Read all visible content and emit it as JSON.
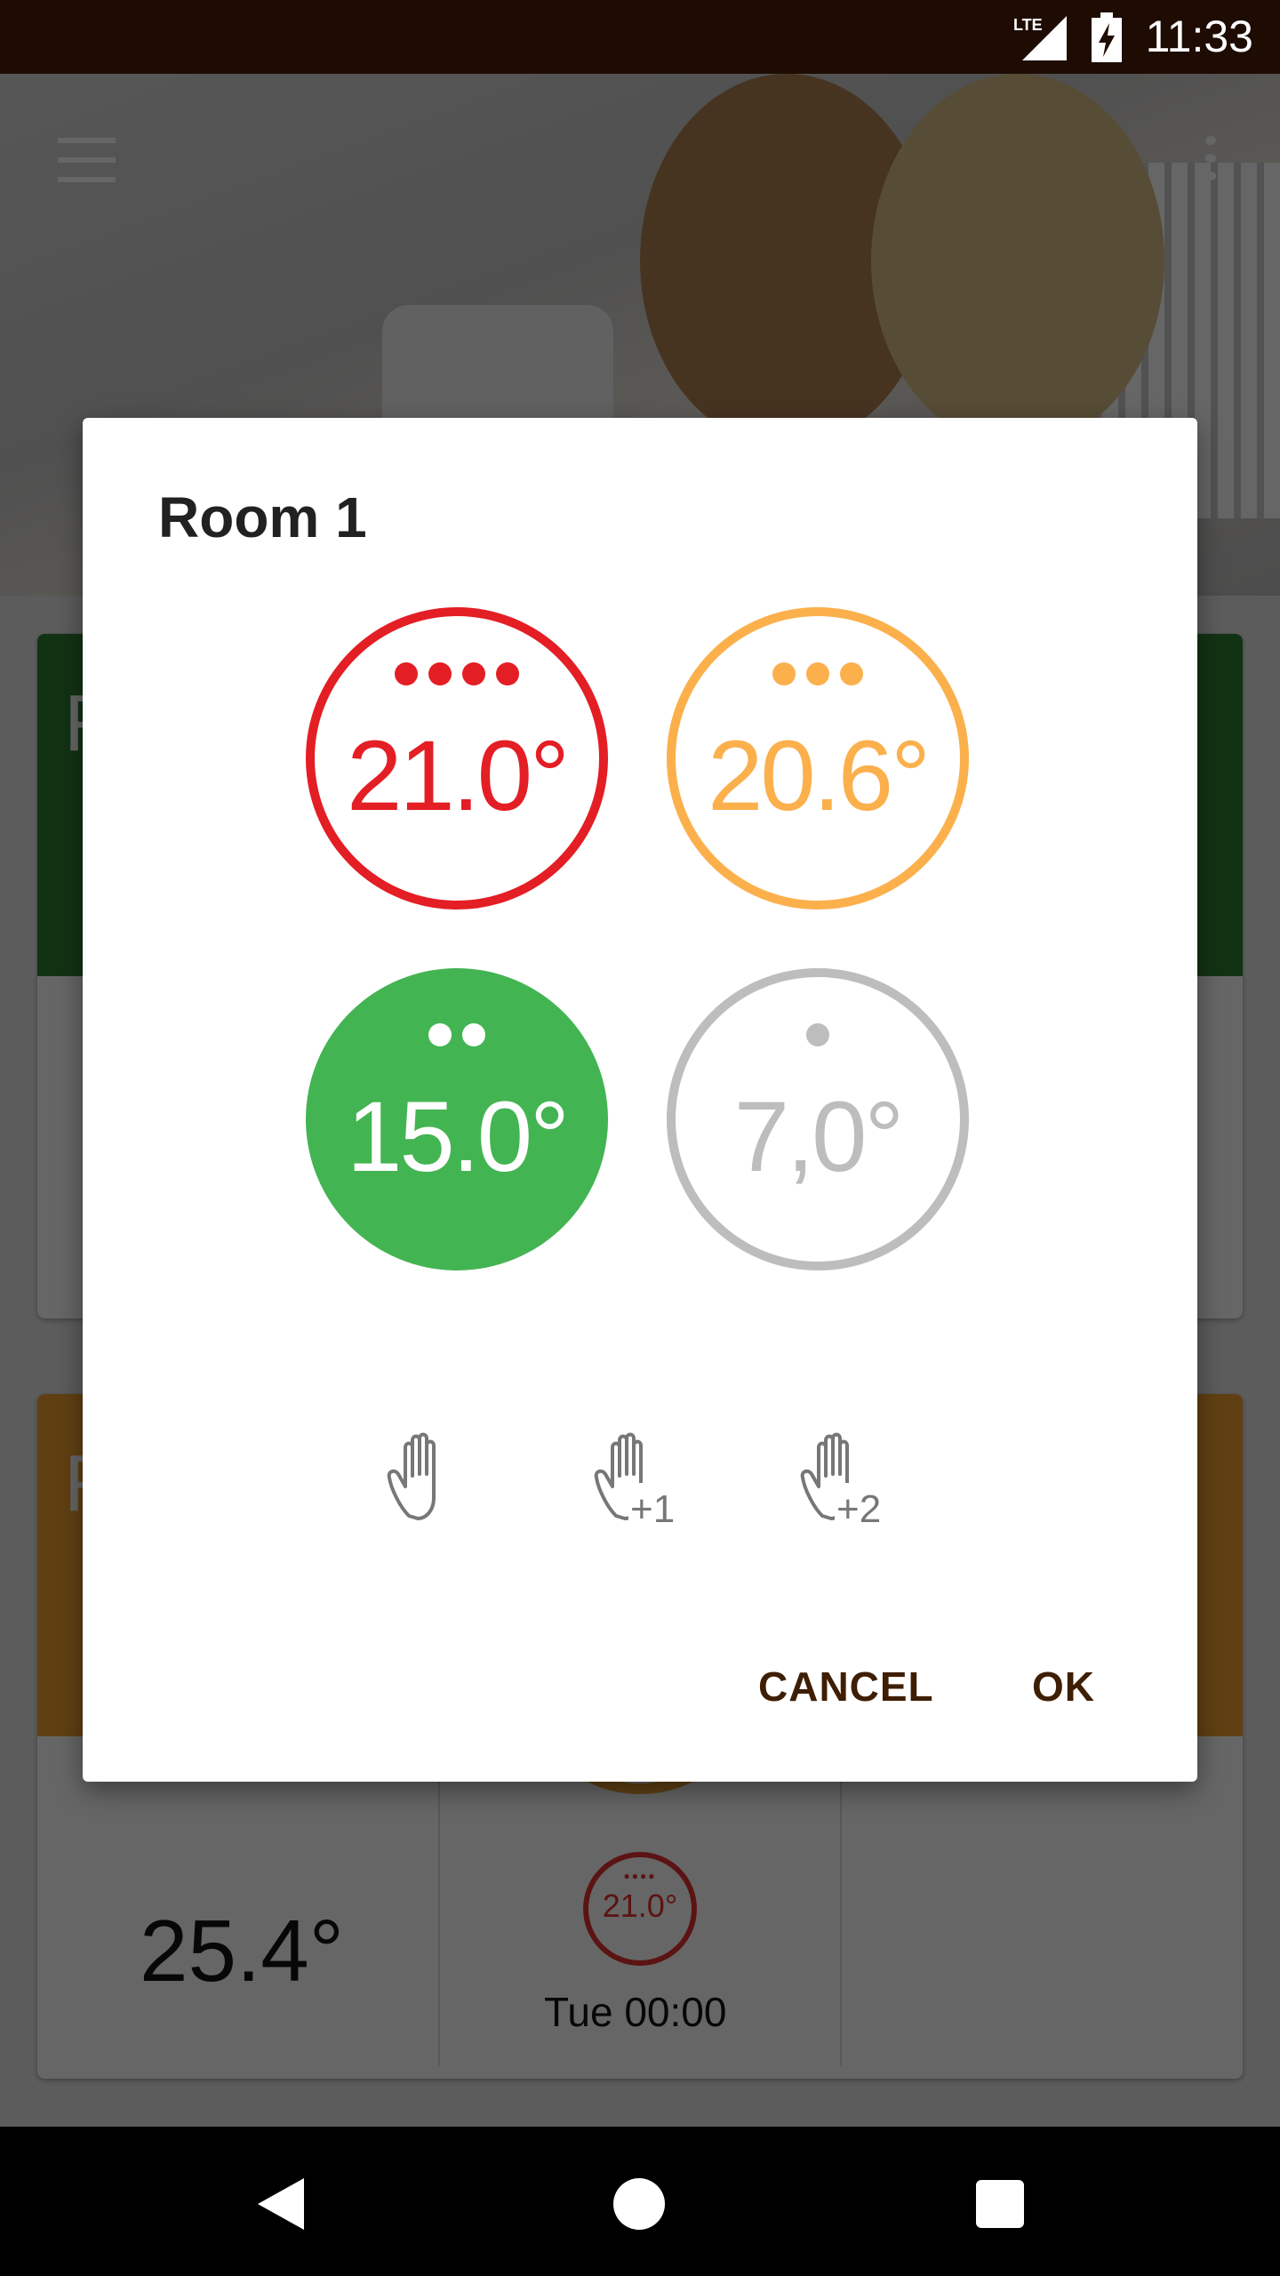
{
  "status_bar": {
    "network": "LTE",
    "time": "11:33"
  },
  "background": {
    "cards": [
      {
        "letter": "R",
        "color": "#2e7d32"
      },
      {
        "letter": "R",
        "color": "#f0a030",
        "current_temp": "25.4°",
        "schedule_temp": "21.0°",
        "schedule_time": "Tue 00:00"
      }
    ]
  },
  "dialog": {
    "title": "Room 1",
    "presets": [
      {
        "label": "21.0°",
        "level": 4,
        "color": "#e31e24",
        "style": "outline"
      },
      {
        "label": "20.6°",
        "level": 3,
        "color": "#fbb04c",
        "style": "outline"
      },
      {
        "label": "15.0°",
        "level": 2,
        "color": "#43b452",
        "style": "filled"
      },
      {
        "label": "7,0°",
        "level": 1,
        "color": "#bdbdbd",
        "style": "outline"
      }
    ],
    "manual_modes": [
      {
        "icon": "hand-icon",
        "suffix": ""
      },
      {
        "icon": "hand-plus-one-icon",
        "suffix": "+1"
      },
      {
        "icon": "hand-plus-two-icon",
        "suffix": "+2"
      }
    ],
    "cancel_label": "CANCEL",
    "ok_label": "OK",
    "button_color": "#3e1e04"
  }
}
